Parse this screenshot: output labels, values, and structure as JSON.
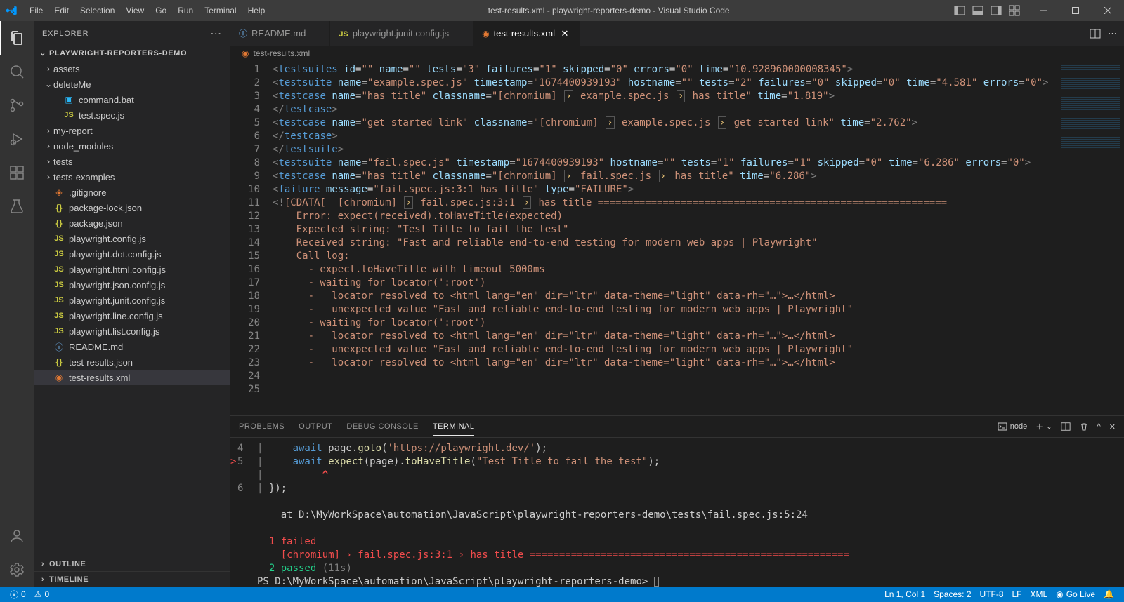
{
  "window": {
    "title": "test-results.xml - playwright-reporters-demo - Visual Studio Code"
  },
  "menu": [
    "File",
    "Edit",
    "Selection",
    "View",
    "Go",
    "Run",
    "Terminal",
    "Help"
  ],
  "explorer": {
    "title": "EXPLORER",
    "root": "PLAYWRIGHT-REPORTERS-DEMO",
    "outline": "OUTLINE",
    "timeline": "TIMELINE",
    "nodes": [
      {
        "type": "folder",
        "name": "assets",
        "depth": 1,
        "open": false
      },
      {
        "type": "folder",
        "name": "deleteMe",
        "depth": 1,
        "open": true
      },
      {
        "type": "file",
        "name": "command.bat",
        "depth": 2,
        "icon": "win"
      },
      {
        "type": "file",
        "name": "test.spec.js",
        "depth": 2,
        "icon": "js"
      },
      {
        "type": "folder",
        "name": "my-report",
        "depth": 1,
        "open": false
      },
      {
        "type": "folder",
        "name": "node_modules",
        "depth": 1,
        "open": false
      },
      {
        "type": "folder",
        "name": "tests",
        "depth": 1,
        "open": false
      },
      {
        "type": "folder",
        "name": "tests-examples",
        "depth": 1,
        "open": false
      },
      {
        "type": "file",
        "name": ".gitignore",
        "depth": 1,
        "icon": "git"
      },
      {
        "type": "file",
        "name": "package-lock.json",
        "depth": 1,
        "icon": "json"
      },
      {
        "type": "file",
        "name": "package.json",
        "depth": 1,
        "icon": "json"
      },
      {
        "type": "file",
        "name": "playwright.config.js",
        "depth": 1,
        "icon": "js"
      },
      {
        "type": "file",
        "name": "playwright.dot.config.js",
        "depth": 1,
        "icon": "js"
      },
      {
        "type": "file",
        "name": "playwright.html.config.js",
        "depth": 1,
        "icon": "js"
      },
      {
        "type": "file",
        "name": "playwright.json.config.js",
        "depth": 1,
        "icon": "js"
      },
      {
        "type": "file",
        "name": "playwright.junit.config.js",
        "depth": 1,
        "icon": "js"
      },
      {
        "type": "file",
        "name": "playwright.line.config.js",
        "depth": 1,
        "icon": "js"
      },
      {
        "type": "file",
        "name": "playwright.list.config.js",
        "depth": 1,
        "icon": "js"
      },
      {
        "type": "file",
        "name": "README.md",
        "depth": 1,
        "icon": "info"
      },
      {
        "type": "file",
        "name": "test-results.json",
        "depth": 1,
        "icon": "json"
      },
      {
        "type": "file",
        "name": "test-results.xml",
        "depth": 1,
        "icon": "rss",
        "selected": true
      }
    ]
  },
  "tabs": [
    {
      "label": "README.md",
      "icon": "info",
      "active": false
    },
    {
      "label": "playwright.junit.config.js",
      "icon": "js",
      "active": false
    },
    {
      "label": "test-results.xml",
      "icon": "rss",
      "active": true
    }
  ],
  "breadcrumb": {
    "icon": "rss",
    "label": "test-results.xml"
  },
  "code": [
    [
      {
        "c": "t-br",
        "t": "<"
      },
      {
        "c": "t-tag",
        "t": "testsuites"
      },
      {
        "c": "",
        "t": " "
      },
      {
        "c": "t-attr",
        "t": "id"
      },
      {
        "c": "t-eq",
        "t": "="
      },
      {
        "c": "t-str",
        "t": "\"\""
      },
      {
        "c": "",
        "t": " "
      },
      {
        "c": "t-attr",
        "t": "name"
      },
      {
        "c": "t-eq",
        "t": "="
      },
      {
        "c": "t-str",
        "t": "\"\""
      },
      {
        "c": "",
        "t": " "
      },
      {
        "c": "t-attr",
        "t": "tests"
      },
      {
        "c": "t-eq",
        "t": "="
      },
      {
        "c": "t-str",
        "t": "\"3\""
      },
      {
        "c": "",
        "t": " "
      },
      {
        "c": "t-attr",
        "t": "failures"
      },
      {
        "c": "t-eq",
        "t": "="
      },
      {
        "c": "t-str",
        "t": "\"1\""
      },
      {
        "c": "",
        "t": " "
      },
      {
        "c": "t-attr",
        "t": "skipped"
      },
      {
        "c": "t-eq",
        "t": "="
      },
      {
        "c": "t-str",
        "t": "\"0\""
      },
      {
        "c": "",
        "t": " "
      },
      {
        "c": "t-attr",
        "t": "errors"
      },
      {
        "c": "t-eq",
        "t": "="
      },
      {
        "c": "t-str",
        "t": "\"0\""
      },
      {
        "c": "",
        "t": " "
      },
      {
        "c": "t-attr",
        "t": "time"
      },
      {
        "c": "t-eq",
        "t": "="
      },
      {
        "c": "t-str",
        "t": "\"10.928960000008345\""
      },
      {
        "c": "t-br",
        "t": ">"
      }
    ],
    [
      {
        "c": "t-br",
        "t": "<"
      },
      {
        "c": "t-tag",
        "t": "testsuite"
      },
      {
        "c": "",
        "t": " "
      },
      {
        "c": "t-attr",
        "t": "name"
      },
      {
        "c": "t-eq",
        "t": "="
      },
      {
        "c": "t-str",
        "t": "\"example.spec.js\""
      },
      {
        "c": "",
        "t": " "
      },
      {
        "c": "t-attr",
        "t": "timestamp"
      },
      {
        "c": "t-eq",
        "t": "="
      },
      {
        "c": "t-str",
        "t": "\"1674400939193\""
      },
      {
        "c": "",
        "t": " "
      },
      {
        "c": "t-attr",
        "t": "hostname"
      },
      {
        "c": "t-eq",
        "t": "="
      },
      {
        "c": "t-str",
        "t": "\"\""
      },
      {
        "c": "",
        "t": " "
      },
      {
        "c": "t-attr",
        "t": "tests"
      },
      {
        "c": "t-eq",
        "t": "="
      },
      {
        "c": "t-str",
        "t": "\"2\""
      },
      {
        "c": "",
        "t": " "
      },
      {
        "c": "t-attr",
        "t": "failures"
      },
      {
        "c": "t-eq",
        "t": "="
      },
      {
        "c": "t-str",
        "t": "\"0\""
      },
      {
        "c": "",
        "t": " "
      },
      {
        "c": "t-attr",
        "t": "skipped"
      },
      {
        "c": "t-eq",
        "t": "="
      },
      {
        "c": "t-str",
        "t": "\"0\""
      },
      {
        "c": "",
        "t": " "
      },
      {
        "c": "t-attr",
        "t": "time"
      },
      {
        "c": "t-eq",
        "t": "="
      },
      {
        "c": "t-str",
        "t": "\"4.581\""
      },
      {
        "c": "",
        "t": " "
      },
      {
        "c": "t-attr",
        "t": "errors"
      },
      {
        "c": "t-eq",
        "t": "="
      },
      {
        "c": "t-str",
        "t": "\"0\""
      },
      {
        "c": "t-br",
        "t": ">"
      }
    ],
    [
      {
        "c": "t-br",
        "t": "<"
      },
      {
        "c": "t-tag",
        "t": "testcase"
      },
      {
        "c": "",
        "t": " "
      },
      {
        "c": "t-attr",
        "t": "name"
      },
      {
        "c": "t-eq",
        "t": "="
      },
      {
        "c": "t-str",
        "t": "\"has title\""
      },
      {
        "c": "",
        "t": " "
      },
      {
        "c": "t-attr",
        "t": "classname"
      },
      {
        "c": "t-eq",
        "t": "="
      },
      {
        "c": "t-str",
        "t": "\"[chromium] "
      },
      {
        "c": "t-box",
        "t": "›"
      },
      {
        "c": "t-str",
        "t": " example.spec.js "
      },
      {
        "c": "t-box",
        "t": "›"
      },
      {
        "c": "t-str",
        "t": " has title\""
      },
      {
        "c": "",
        "t": " "
      },
      {
        "c": "t-attr",
        "t": "time"
      },
      {
        "c": "t-eq",
        "t": "="
      },
      {
        "c": "t-str",
        "t": "\"1.819\""
      },
      {
        "c": "t-br",
        "t": ">"
      }
    ],
    [
      {
        "c": "t-br",
        "t": "</"
      },
      {
        "c": "t-tag",
        "t": "testcase"
      },
      {
        "c": "t-br",
        "t": ">"
      }
    ],
    [
      {
        "c": "t-br",
        "t": "<"
      },
      {
        "c": "t-tag",
        "t": "testcase"
      },
      {
        "c": "",
        "t": " "
      },
      {
        "c": "t-attr",
        "t": "name"
      },
      {
        "c": "t-eq",
        "t": "="
      },
      {
        "c": "t-str",
        "t": "\"get started link\""
      },
      {
        "c": "",
        "t": " "
      },
      {
        "c": "t-attr",
        "t": "classname"
      },
      {
        "c": "t-eq",
        "t": "="
      },
      {
        "c": "t-str",
        "t": "\"[chromium] "
      },
      {
        "c": "t-box",
        "t": "›"
      },
      {
        "c": "t-str",
        "t": " example.spec.js "
      },
      {
        "c": "t-box",
        "t": "›"
      },
      {
        "c": "t-str",
        "t": " get started link\""
      },
      {
        "c": "",
        "t": " "
      },
      {
        "c": "t-attr",
        "t": "time"
      },
      {
        "c": "t-eq",
        "t": "="
      },
      {
        "c": "t-str",
        "t": "\"2.762\""
      },
      {
        "c": "t-br",
        "t": ">"
      }
    ],
    [
      {
        "c": "t-br",
        "t": "</"
      },
      {
        "c": "t-tag",
        "t": "testcase"
      },
      {
        "c": "t-br",
        "t": ">"
      }
    ],
    [
      {
        "c": "t-br",
        "t": "</"
      },
      {
        "c": "t-tag",
        "t": "testsuite"
      },
      {
        "c": "t-br",
        "t": ">"
      }
    ],
    [
      {
        "c": "t-br",
        "t": "<"
      },
      {
        "c": "t-tag",
        "t": "testsuite"
      },
      {
        "c": "",
        "t": " "
      },
      {
        "c": "t-attr",
        "t": "name"
      },
      {
        "c": "t-eq",
        "t": "="
      },
      {
        "c": "t-str",
        "t": "\"fail.spec.js\""
      },
      {
        "c": "",
        "t": " "
      },
      {
        "c": "t-attr",
        "t": "timestamp"
      },
      {
        "c": "t-eq",
        "t": "="
      },
      {
        "c": "t-str",
        "t": "\"1674400939193\""
      },
      {
        "c": "",
        "t": " "
      },
      {
        "c": "t-attr",
        "t": "hostname"
      },
      {
        "c": "t-eq",
        "t": "="
      },
      {
        "c": "t-str",
        "t": "\"\""
      },
      {
        "c": "",
        "t": " "
      },
      {
        "c": "t-attr",
        "t": "tests"
      },
      {
        "c": "t-eq",
        "t": "="
      },
      {
        "c": "t-str",
        "t": "\"1\""
      },
      {
        "c": "",
        "t": " "
      },
      {
        "c": "t-attr",
        "t": "failures"
      },
      {
        "c": "t-eq",
        "t": "="
      },
      {
        "c": "t-str",
        "t": "\"1\""
      },
      {
        "c": "",
        "t": " "
      },
      {
        "c": "t-attr",
        "t": "skipped"
      },
      {
        "c": "t-eq",
        "t": "="
      },
      {
        "c": "t-str",
        "t": "\"0\""
      },
      {
        "c": "",
        "t": " "
      },
      {
        "c": "t-attr",
        "t": "time"
      },
      {
        "c": "t-eq",
        "t": "="
      },
      {
        "c": "t-str",
        "t": "\"6.286\""
      },
      {
        "c": "",
        "t": " "
      },
      {
        "c": "t-attr",
        "t": "errors"
      },
      {
        "c": "t-eq",
        "t": "="
      },
      {
        "c": "t-str",
        "t": "\"0\""
      },
      {
        "c": "t-br",
        "t": ">"
      }
    ],
    [
      {
        "c": "t-br",
        "t": "<"
      },
      {
        "c": "t-tag",
        "t": "testcase"
      },
      {
        "c": "",
        "t": " "
      },
      {
        "c": "t-attr",
        "t": "name"
      },
      {
        "c": "t-eq",
        "t": "="
      },
      {
        "c": "t-str",
        "t": "\"has title\""
      },
      {
        "c": "",
        "t": " "
      },
      {
        "c": "t-attr",
        "t": "classname"
      },
      {
        "c": "t-eq",
        "t": "="
      },
      {
        "c": "t-str",
        "t": "\"[chromium] "
      },
      {
        "c": "t-box",
        "t": "›"
      },
      {
        "c": "t-str",
        "t": " fail.spec.js "
      },
      {
        "c": "t-box",
        "t": "›"
      },
      {
        "c": "t-str",
        "t": " has title\""
      },
      {
        "c": "",
        "t": " "
      },
      {
        "c": "t-attr",
        "t": "time"
      },
      {
        "c": "t-eq",
        "t": "="
      },
      {
        "c": "t-str",
        "t": "\"6.286\""
      },
      {
        "c": "t-br",
        "t": ">"
      }
    ],
    [
      {
        "c": "t-br",
        "t": "<"
      },
      {
        "c": "t-tag",
        "t": "failure"
      },
      {
        "c": "",
        "t": " "
      },
      {
        "c": "t-attr",
        "t": "message"
      },
      {
        "c": "t-eq",
        "t": "="
      },
      {
        "c": "t-str",
        "t": "\"fail.spec.js:3:1 has title\""
      },
      {
        "c": "",
        "t": " "
      },
      {
        "c": "t-attr",
        "t": "type"
      },
      {
        "c": "t-eq",
        "t": "="
      },
      {
        "c": "t-str",
        "t": "\"FAILURE\""
      },
      {
        "c": "t-br",
        "t": ">"
      }
    ],
    [
      {
        "c": "t-br",
        "t": "<!"
      },
      {
        "c": "t-txt",
        "t": "[CDATA[  [chromium] "
      },
      {
        "c": "t-box",
        "t": "›"
      },
      {
        "c": "t-txt",
        "t": " fail.spec.js:3:1 "
      },
      {
        "c": "t-box",
        "t": "›"
      },
      {
        "c": "t-txt",
        "t": " has title ==========================================================="
      }
    ],
    [
      {
        "c": "t-txt",
        "t": ""
      }
    ],
    [
      {
        "c": "t-txt",
        "t": "    Error: expect(received).toHaveTitle(expected)"
      }
    ],
    [
      {
        "c": "t-txt",
        "t": ""
      }
    ],
    [
      {
        "c": "t-txt",
        "t": "    Expected string: \"Test Title to fail the test\""
      }
    ],
    [
      {
        "c": "t-txt",
        "t": "    Received string: \"Fast and reliable end-to-end testing for modern web apps | Playwright\""
      }
    ],
    [
      {
        "c": "t-txt",
        "t": "    Call log:"
      }
    ],
    [
      {
        "c": "t-txt",
        "t": "      - expect.toHaveTitle with timeout 5000ms"
      }
    ],
    [
      {
        "c": "t-txt",
        "t": "      - waiting for locator(':root')"
      }
    ],
    [
      {
        "c": "t-txt",
        "t": "      -   locator resolved to <html lang=\"en\" dir=\"ltr\" data-theme=\"light\" data-rh=\"…\">…</html>"
      }
    ],
    [
      {
        "c": "t-txt",
        "t": "      -   unexpected value \"Fast and reliable end-to-end testing for modern web apps | Playwright\""
      }
    ],
    [
      {
        "c": "t-txt",
        "t": "      - waiting for locator(':root')"
      }
    ],
    [
      {
        "c": "t-txt",
        "t": "      -   locator resolved to <html lang=\"en\" dir=\"ltr\" data-theme=\"light\" data-rh=\"…\">…</html>"
      }
    ],
    [
      {
        "c": "t-txt",
        "t": "      -   unexpected value \"Fast and reliable end-to-end testing for modern web apps | Playwright\""
      }
    ],
    [
      {
        "c": "t-txt",
        "t": "      -   locator resolved to <html lang=\"en\" dir=\"ltr\" data-theme=\"light\" data-rh=\"…\">…</html>"
      }
    ]
  ],
  "panel": {
    "tabs": [
      "PROBLEMS",
      "OUTPUT",
      "DEBUG CONSOLE",
      "TERMINAL"
    ],
    "activeTab": 3,
    "shell": "node"
  },
  "terminal": {
    "lines": [
      {
        "num": "4",
        "pipe": true,
        "html": "    <span class='c-kw'>await</span> page.<span class='c-fn'>goto</span>(<span class='c-str'>'https://playwright.dev/'</span>);"
      },
      {
        "num": "5",
        "pipe": true,
        "mark": ">",
        "html": "    <span class='c-kw'>await</span> <span class='c-fn'>expect</span>(page).<span class='c-fn'>toHaveTitle</span>(<span class='c-str'>\"Test Title to fail the test\"</span>);"
      },
      {
        "num": "",
        "pipe": true,
        "html": "         <span class='c-warn'>^</span>"
      },
      {
        "num": "6",
        "pipe": true,
        "html": "});"
      },
      {
        "html": ""
      },
      {
        "html": "    at D:\\MyWorkSpace\\automation\\JavaScript\\playwright-reporters-demo\\tests\\fail.spec.js:5:24"
      },
      {
        "html": ""
      },
      {
        "html": "  <span class='c-red'>1 failed</span>"
      },
      {
        "html": "    <span class='c-red'>[chromium] › fail.spec.js:3:1 › has title ======================================================</span>"
      },
      {
        "html": "  <span class='c-grn'>2 passed</span> <span class='c-dim'>(11s)</span>"
      },
      {
        "html": "PS D:\\MyWorkSpace\\automation\\JavaScript\\playwright-reporters-demo> <span style='border:1px solid #888;display:inline-block;width:7px;height:14px;vertical-align:middle;'></span>"
      }
    ]
  },
  "status": {
    "errors": "0",
    "warnings": "0",
    "pos": "Ln 1, Col 1",
    "spaces": "Spaces: 2",
    "encoding": "UTF-8",
    "eol": "LF",
    "lang": "XML",
    "golive": "Go Live"
  }
}
